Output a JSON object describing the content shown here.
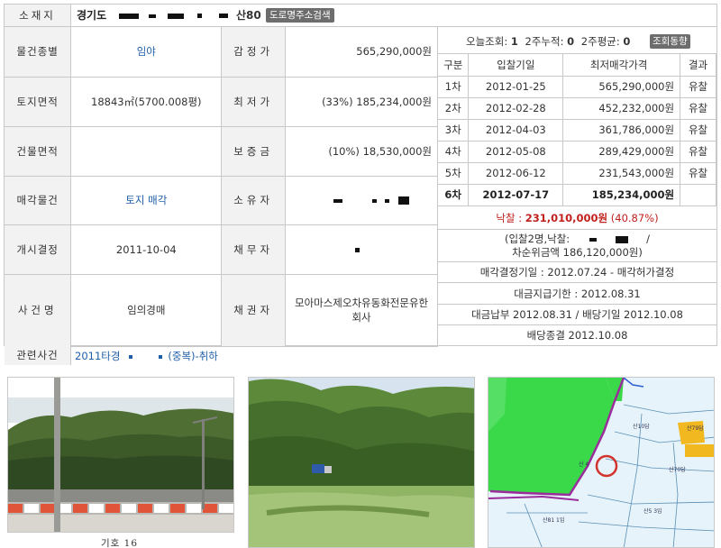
{
  "address": {
    "label": "소재지",
    "prefix": "경기도",
    "suffix": "산80",
    "road_button": "도로명주소검색"
  },
  "details": [
    {
      "label": "물건종별",
      "value": "임야",
      "label2": "감정가",
      "value2": "565,290,000원"
    },
    {
      "label": "토지면적",
      "value": "18843㎡(5700.008평)",
      "label2": "최저가",
      "value2": "(33%) 185,234,000원"
    },
    {
      "label": "건물면적",
      "value": "",
      "label2": "보증금",
      "value2": "(10%) 18,530,000원"
    },
    {
      "label": "매각물건",
      "value": "토지 매각",
      "label2": "소유자",
      "value2": ""
    },
    {
      "label": "개시결정",
      "value": "2011-10-04",
      "label2": "채무자",
      "value2": ""
    },
    {
      "label": "사건명",
      "value": "임의경매",
      "label2": "채권자",
      "value2": "모아마스제오차유동화전문유한회사"
    }
  ],
  "stats": {
    "today_label": "오늘조회:",
    "today_value": "1",
    "week2_label": "2주누적:",
    "week2_value": "0",
    "avg2_label": "2주평균:",
    "avg2_value": "0",
    "trend_button": "조회동향"
  },
  "bid_table": {
    "headers": [
      "구분",
      "입찰기일",
      "최저매각가격",
      "결과"
    ],
    "rows": [
      {
        "round": "1차",
        "date": "2012-01-25",
        "price": "565,290,000원",
        "result": "유찰"
      },
      {
        "round": "2차",
        "date": "2012-02-28",
        "price": "452,232,000원",
        "result": "유찰"
      },
      {
        "round": "3차",
        "date": "2012-04-03",
        "price": "361,786,000원",
        "result": "유찰"
      },
      {
        "round": "4차",
        "date": "2012-05-08",
        "price": "289,429,000원",
        "result": "유찰"
      },
      {
        "round": "5차",
        "date": "2012-06-12",
        "price": "231,543,000원",
        "result": "유찰"
      },
      {
        "round": "6차",
        "date": "2012-07-17",
        "price": "185,234,000원",
        "result": ""
      }
    ]
  },
  "sale": {
    "label": "낙찰 :",
    "amount": "231,010,000원",
    "rate": "(40.87%)",
    "bidders_line": "(입찰2명,낙찰:",
    "bidders_tail": "/",
    "second_line": "차순위금액 186,120,000원)",
    "decision": "매각결정기일 : 2012.07.24 - 매각허가결정",
    "payment_due": "대금지급기한 : 2012.08.31",
    "payment": "대금납부 2012.08.31 / 배당기일 2012.10.08",
    "dividend_end": "배당종결 2012.10.08"
  },
  "related": {
    "label": "관련사건",
    "value": "2011타경",
    "value_tail": "(중복)-취하"
  },
  "photos": {
    "caption": "기호 16"
  }
}
